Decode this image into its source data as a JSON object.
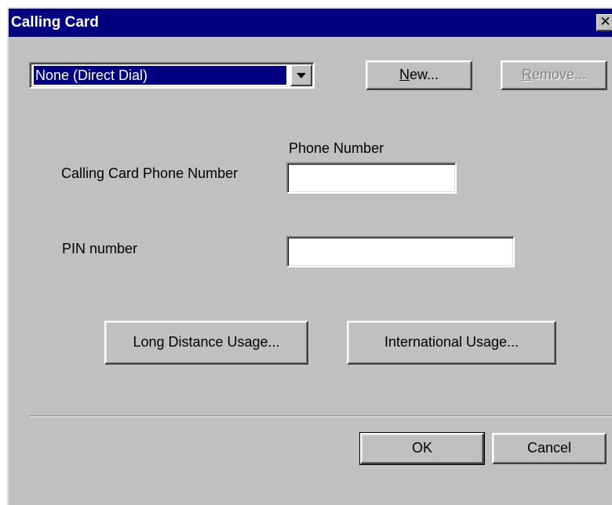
{
  "window": {
    "title": "Calling Card",
    "close_glyph": "✕"
  },
  "card_select": {
    "selected": "None (Direct Dial)"
  },
  "buttons": {
    "new": {
      "accel": "N",
      "rest": "ew..."
    },
    "remove": {
      "accel": "R",
      "rest": "emove..."
    },
    "long_distance": "Long Distance Usage...",
    "international": "International Usage...",
    "ok": "OK",
    "cancel": "Cancel"
  },
  "fields": {
    "phone_number_header": "Phone Number",
    "calling_card_phone_label": "Calling Card Phone Number",
    "calling_card_phone_value": "",
    "pin_label": "PIN number",
    "pin_value": ""
  },
  "icons": {
    "close": "close-icon",
    "dropdown": "chevron-down-icon"
  }
}
